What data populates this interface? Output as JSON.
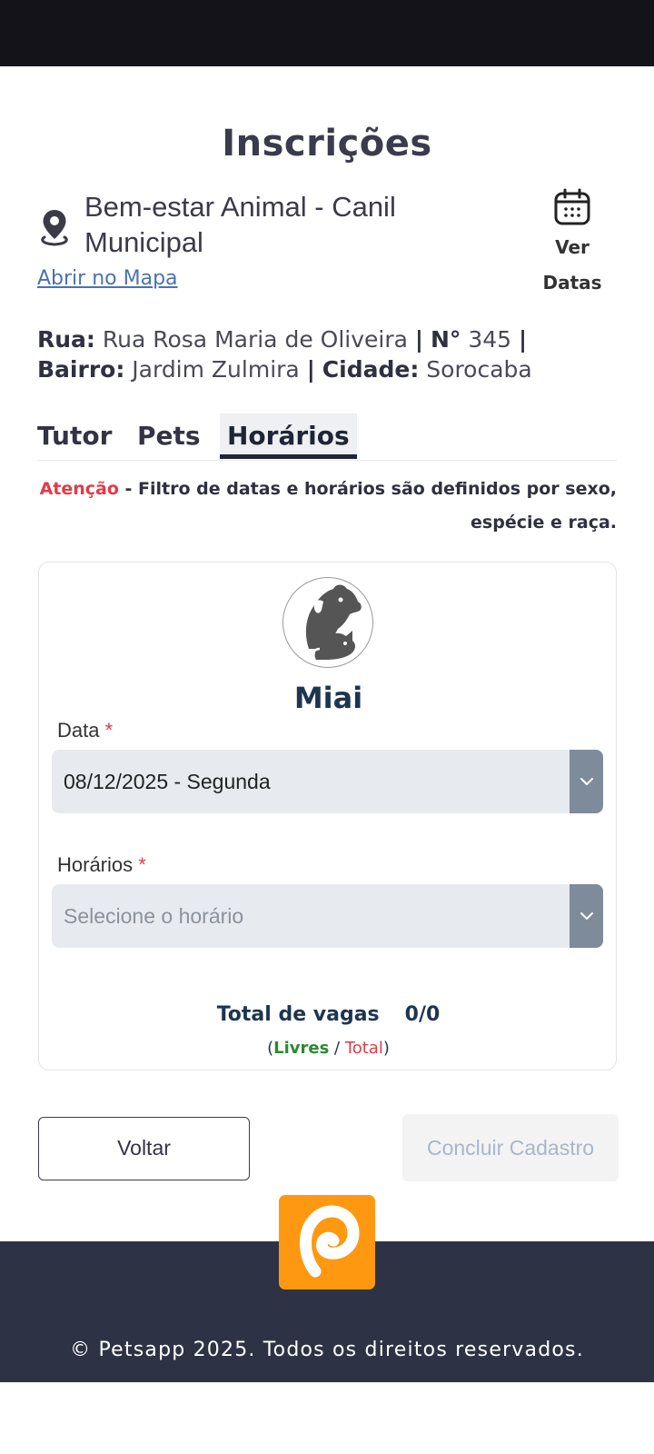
{
  "page": {
    "title": "Inscrições"
  },
  "location": {
    "name": "Bem-estar Animal - Canil Municipal",
    "map_link": "Abrir no Mapa",
    "dates_button": {
      "line1": "Ver",
      "line2": "Datas"
    }
  },
  "address": {
    "street_label": "Rua:",
    "street": "Rua Rosa Maria de Oliveira",
    "number_label": "N°",
    "number": "345",
    "district_label": "Bairro:",
    "district": "Jardim Zulmira",
    "city_label": "Cidade:",
    "city": "Sorocaba",
    "separator": "|"
  },
  "tabs": [
    {
      "label": "Tutor",
      "active": false
    },
    {
      "label": "Pets",
      "active": false
    },
    {
      "label": "Horários",
      "active": true
    }
  ],
  "notice": {
    "highlight": "Atenção",
    "text": " - Filtro de datas e horários são definidos por sexo, espécie e raça."
  },
  "pet": {
    "name": "Miai"
  },
  "form": {
    "date": {
      "label": "Data",
      "required_mark": "*",
      "value": "08/12/2025 - Segunda"
    },
    "time": {
      "label": "Horários",
      "required_mark": "*",
      "placeholder": "Selecione o horário"
    }
  },
  "vagas": {
    "label": "Total de vagas",
    "value": "0/0",
    "legend_open": "(",
    "legend_free": "Livres",
    "legend_sep": " / ",
    "legend_total": "Total",
    "legend_close": ")"
  },
  "actions": {
    "back": "Voltar",
    "submit": "Concluir Cadastro"
  },
  "footer": {
    "copyright": "© Petsapp 2025. Todos os direitos reservados."
  },
  "colors": {
    "accent_orange": "#ff9811",
    "footer_bg": "#2d3344",
    "warning_red": "#e23a48",
    "free_green": "#2b8a32"
  }
}
